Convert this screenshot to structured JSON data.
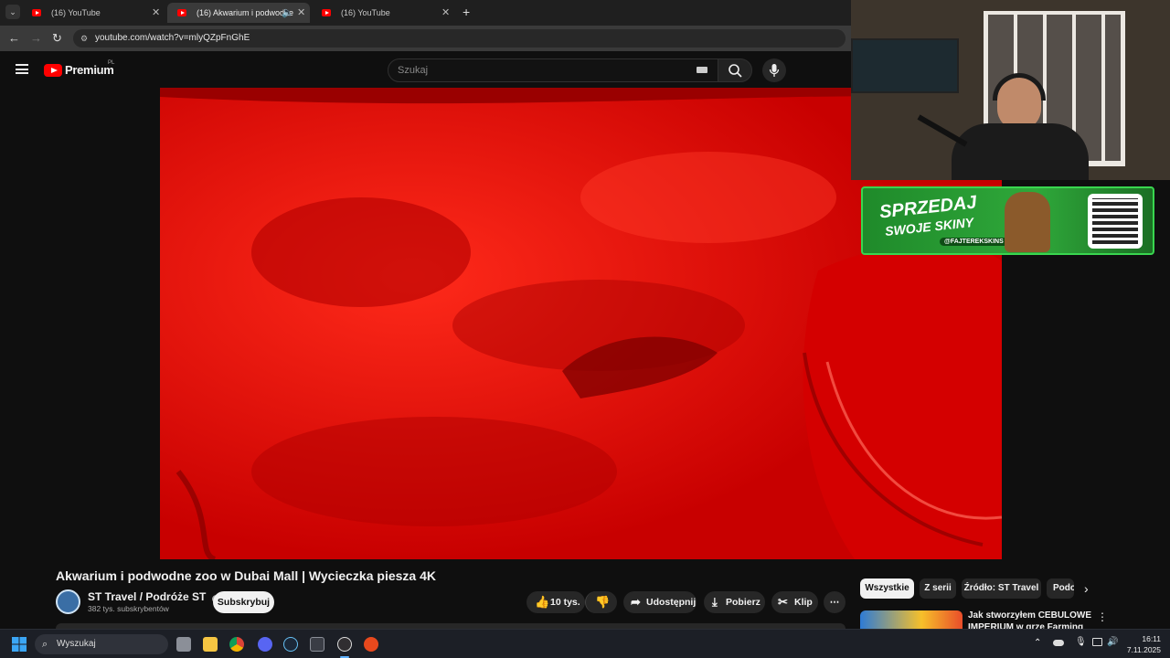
{
  "browser": {
    "tabs": [
      {
        "label": "(16) YouTube",
        "active": false
      },
      {
        "label": "(16) Akwarium i podwodne",
        "active": true
      },
      {
        "label": "(16) YouTube",
        "active": false
      }
    ],
    "url": "youtube.com/watch?v=mlyQZpFnGhE",
    "new_tab": "+"
  },
  "youtube": {
    "logo_text": "Premium",
    "region": "PL",
    "search_placeholder": "Szukaj"
  },
  "overlay": {
    "banner_line1": "SPRZEDAJ",
    "banner_line2": "SWOJE SKINY",
    "banner_handle": "@FAJTEREKSKINS"
  },
  "video": {
    "title": "Akwarium i podwodne zoo w Dubai Mall | Wycieczka piesza 4K",
    "channel": "ST Travel / Podróże ST",
    "subscribers": "382 tys. subskrybentów",
    "subscribe_label": "Subskrybuj",
    "likes": "10 tys.",
    "share_label": "Udostępnij",
    "download_label": "Pobierz",
    "clip_label": "Klip"
  },
  "sidebar": {
    "chips": [
      "Wszystkie",
      "Z serii",
      "Źródło: ST Travel",
      "Podo"
    ],
    "rec_title_line1": "Jak stworzyłem CEBULOWE",
    "rec_title_line2": "IMPERIUM w grze Farming"
  },
  "taskbar": {
    "search_placeholder": "Wyszukaj",
    "time": "16:11",
    "date": "7.11.2025"
  }
}
